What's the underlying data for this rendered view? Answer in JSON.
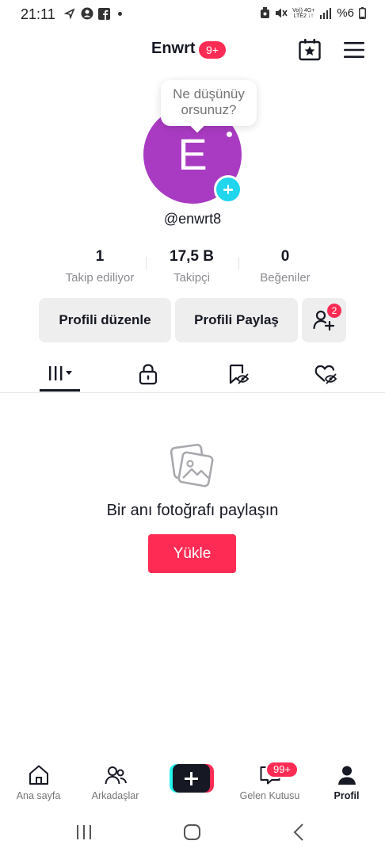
{
  "status_bar": {
    "time": "21:11",
    "network_top": "Vo)) 4G+",
    "network_bottom": "LTE2 ↓↑",
    "battery": "%6"
  },
  "header": {
    "title": "Enwrt",
    "badge": "9+",
    "icons": [
      "calendar-star-icon",
      "hamburger-menu-icon"
    ]
  },
  "profile": {
    "avatar_letter": "E",
    "avatar_color": "#a93bc2",
    "bubble_line1": "Ne düşünüy",
    "bubble_line2": "orsunuz?",
    "username": "@enwrt8"
  },
  "stats": [
    {
      "value": "1",
      "label": "Takip ediliyor"
    },
    {
      "value": "17,5 B",
      "label": "Takipçi"
    },
    {
      "value": "0",
      "label": "Beğeniler"
    }
  ],
  "actions": {
    "edit_profile": "Profili düzenle",
    "share_profile": "Profili Paylaş",
    "friends_badge": "2"
  },
  "tabs": [
    {
      "name": "videos",
      "icon": "grid-columns-icon",
      "active": true
    },
    {
      "name": "private",
      "icon": "lock-icon",
      "active": false
    },
    {
      "name": "reposts",
      "icon": "eye-slash-bookmark-icon",
      "active": false
    },
    {
      "name": "liked",
      "icon": "eye-slash-heart-icon",
      "active": false
    }
  ],
  "empty_state": {
    "icon": "photo-stack-icon",
    "title": "Bir anı fotoğrafı paylaşın",
    "button": "Yükle"
  },
  "bottom_nav": [
    {
      "label": "Ana sayfa",
      "icon": "home-icon",
      "active": false
    },
    {
      "label": "Arkadaşlar",
      "icon": "friends-icon",
      "active": false
    },
    {
      "label": "",
      "icon": "create-plus-icon",
      "active": false
    },
    {
      "label": "Gelen Kutusu",
      "icon": "inbox-icon",
      "active": false,
      "badge": "99+"
    },
    {
      "label": "Profil",
      "icon": "profile-icon",
      "active": true
    }
  ],
  "colors": {
    "accent": "#fe2c55",
    "cyan": "#25f4ee",
    "text": "#161823",
    "muted": "#8a8b91"
  }
}
